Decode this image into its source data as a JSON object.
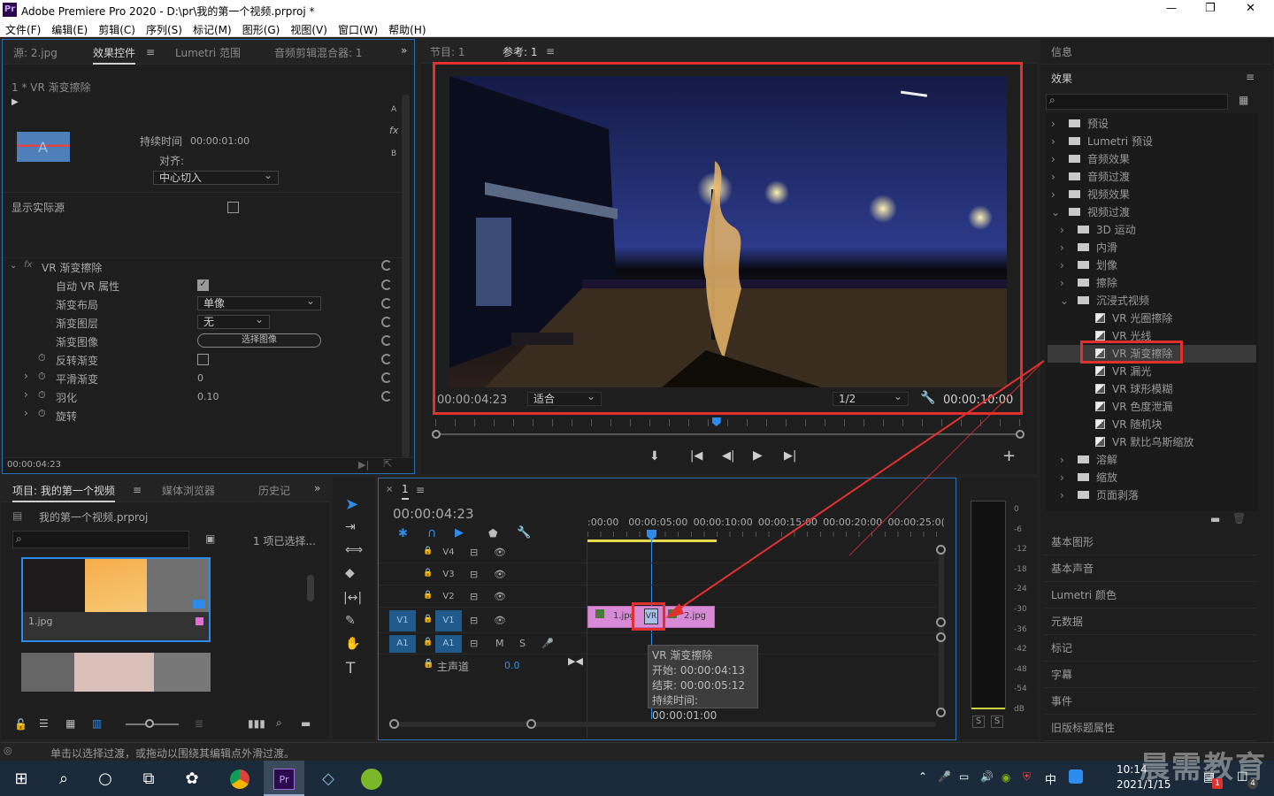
{
  "app": {
    "title": "Adobe Premiere Pro 2020 - D:\\pr\\我的第一个视频.prproj *",
    "logo": "Pr",
    "window_controls": [
      "—",
      "❐",
      "✕"
    ]
  },
  "menu": [
    "文件(F)",
    "编辑(E)",
    "剪辑(C)",
    "序列(S)",
    "标记(M)",
    "图形(G)",
    "视图(V)",
    "窗口(W)",
    "帮助(H)"
  ],
  "source_panel": {
    "tabs": [
      "源: 2.jpg",
      "效果控件",
      "Lumetri 范围",
      "音频剪辑混合器: 1"
    ],
    "active_tab": "效果控件",
    "clip_label": "1 * VR 渐变擦除",
    "thumb_letter": "A",
    "side_letters": [
      "A",
      "fx",
      "B"
    ],
    "duration_label": "持续时间",
    "duration_value": "00:00:01:00",
    "align_label": "对齐:",
    "align_value": "中心切入",
    "show_source_label": "显示实际源",
    "effect_name": "VR 渐变擦除",
    "props": [
      {
        "label": "自动 VR 属性",
        "type": "checkbox",
        "checked": true
      },
      {
        "label": "渐变布局",
        "type": "dropdown",
        "value": "单像"
      },
      {
        "label": "渐变图层",
        "type": "dropdown",
        "value": "无"
      },
      {
        "label": "渐变图像",
        "type": "button",
        "value": "选择图像"
      },
      {
        "label": "反转渐变",
        "type": "checkbox",
        "checked": false
      },
      {
        "label": "平滑渐变",
        "type": "value",
        "value": "0"
      },
      {
        "label": "羽化",
        "type": "value",
        "value": "0.10"
      },
      {
        "label": "旋转",
        "type": "none",
        "value": ""
      }
    ],
    "timecode": "00:00:04:23"
  },
  "program_panel": {
    "tabs": [
      "节目: 1",
      "参考: 1"
    ],
    "active_tab": "参考: 1",
    "timecode_left": "00:00:04:23",
    "fit": "适合",
    "resolution": "1/2",
    "timecode_right": "00:00:10:00",
    "playhead_fraction": 0.48
  },
  "project_panel": {
    "tabs": [
      "项目: 我的第一个视频",
      "媒体浏览器",
      "历史记"
    ],
    "active_tab": "项目: 我的第一个视频",
    "project_file": "我的第一个视频.prproj",
    "selection_status": "1 项已选择...",
    "items": [
      {
        "name": "1.jpg"
      },
      {
        "name": ""
      }
    ]
  },
  "timeline": {
    "tab": "1",
    "timecode": "00:00:04:23",
    "ruler": [
      ":00:00",
      "00:00:05:00",
      "00:00:10:00",
      "00:00:15:00",
      "00:00:20:00",
      "00:00:25:0("
    ],
    "tracks": [
      "V4",
      "V3",
      "V2",
      "V1",
      "A1"
    ],
    "source_v": "V1",
    "source_a": "A1",
    "master_label": "主声道",
    "master_value": "0.0",
    "clips": [
      {
        "name": "1.jpg"
      },
      {
        "name": "2.jpg"
      }
    ],
    "transition_label": "VR",
    "tooltip": {
      "title": "VR 渐变擦除",
      "start": "开始: 00:00:04:13",
      "end": "结束: 00:00:05:12",
      "duration": "持续时间: 00:00:01:00"
    }
  },
  "audio_meter": {
    "scale": [
      "0",
      "-6",
      "-12",
      "-18",
      "-24",
      "-30",
      "-36",
      "-42",
      "-48",
      "-54",
      "dB"
    ],
    "solo": [
      "S",
      "S"
    ]
  },
  "right_panel": {
    "info": "信息",
    "effects_title": "效果",
    "tree": [
      {
        "label": "预设",
        "level": 0,
        "kind": "folder",
        "expanded": false
      },
      {
        "label": "Lumetri 预设",
        "level": 0,
        "kind": "folder",
        "expanded": false
      },
      {
        "label": "音频效果",
        "level": 0,
        "kind": "folder",
        "expanded": false
      },
      {
        "label": "音频过渡",
        "level": 0,
        "kind": "folder",
        "expanded": false
      },
      {
        "label": "视频效果",
        "level": 0,
        "kind": "folder",
        "expanded": false
      },
      {
        "label": "视频过渡",
        "level": 0,
        "kind": "folder",
        "expanded": true
      },
      {
        "label": "3D 运动",
        "level": 1,
        "kind": "folder",
        "expanded": false
      },
      {
        "label": "内滑",
        "level": 1,
        "kind": "folder",
        "expanded": false
      },
      {
        "label": "划像",
        "level": 1,
        "kind": "folder",
        "expanded": false
      },
      {
        "label": "擦除",
        "level": 1,
        "kind": "folder",
        "expanded": false
      },
      {
        "label": "沉浸式视频",
        "level": 1,
        "kind": "folder",
        "expanded": true
      },
      {
        "label": "VR 光圈擦除",
        "level": 2,
        "kind": "effect"
      },
      {
        "label": "VR 光线",
        "level": 2,
        "kind": "effect"
      },
      {
        "label": "VR 渐变擦除",
        "level": 2,
        "kind": "effect",
        "selected": true
      },
      {
        "label": "VR 漏光",
        "level": 2,
        "kind": "effect"
      },
      {
        "label": "VR 球形模糊",
        "level": 2,
        "kind": "effect"
      },
      {
        "label": "VR 色度泄漏",
        "level": 2,
        "kind": "effect"
      },
      {
        "label": "VR 随机块",
        "level": 2,
        "kind": "effect"
      },
      {
        "label": "VR 默比乌斯缩放",
        "level": 2,
        "kind": "effect"
      },
      {
        "label": "溶解",
        "level": 1,
        "kind": "folder",
        "expanded": false
      },
      {
        "label": "缩放",
        "level": 1,
        "kind": "folder",
        "expanded": false
      },
      {
        "label": "页面剥落",
        "level": 1,
        "kind": "folder",
        "expanded": false
      }
    ],
    "panels": [
      "基本图形",
      "基本声音",
      "Lumetri 颜色",
      "元数据",
      "标记",
      "字幕",
      "事件",
      "旧版标题属性"
    ]
  },
  "status_bar": "单击以选择过渡，或拖动以围绕其编辑点外滑过渡。",
  "taskbar": {
    "time": "10:14",
    "date": "2021/1/15",
    "ime": "中",
    "watermark": "晨需教育",
    "badge_a": "1",
    "badge_b": "4"
  },
  "colors": {
    "highlight_red": "#e0312f",
    "accent_blue": "#2d8ceb",
    "clip_pink": "#d98ad6",
    "selected_track": "#1f5a8a"
  }
}
